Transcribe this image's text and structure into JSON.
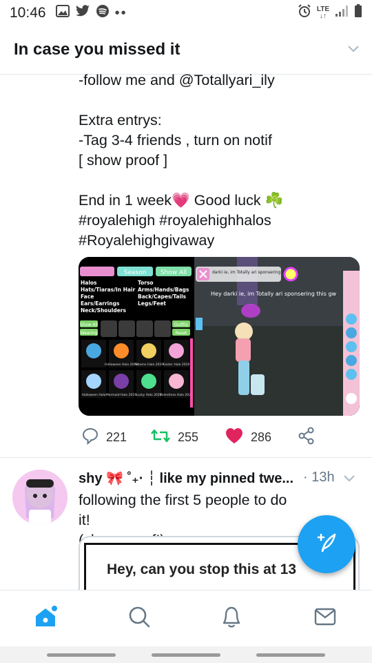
{
  "status_bar": {
    "time": "10:46",
    "network": "LTE",
    "left_icons": [
      "gallery-icon",
      "twitter-icon",
      "spotify-icon",
      "more-dots-icon"
    ],
    "right_icons": [
      "alarm-icon",
      "lte-icon",
      "signal-icon",
      "battery-icon"
    ]
  },
  "header": {
    "title": "In case you missed it"
  },
  "tweet1": {
    "text_lines": [
      "-follow me and @Totallyari_ily",
      "",
      "Extra entrys:",
      "-Tag 3-4 friends , turn on notif",
      "[ show proof ]",
      "",
      "End in 1 week💗 Good luck ☘️",
      "#royalehigh #royalehighhalos",
      "#Royalehighgivaway"
    ],
    "media": {
      "tabs": [
        "Season",
        "Show All"
      ],
      "categories_left": [
        "Halos",
        "Hats/Tiaras/In Hair",
        "Face",
        "Ears/Earrings",
        "Neck/Shoulders"
      ],
      "categories_right": [
        "Torso",
        "Arms/Hands/Bags",
        "Back/Capes/Tails",
        "Legs/Feet"
      ],
      "buttons": [
        "Show All",
        "Wearing",
        "Outfits",
        "Reset"
      ],
      "item_names": [
        "Halloween Halo 2019",
        "Autumn Halo 2019",
        "Easter Halo 2019",
        "Halloween Halo",
        "Mermaid Halo 2019",
        "Lucky Halo 2020",
        "Valentines Halo 2020"
      ],
      "chat_bubble": "darki ie, im Totally ari sponsering this gw",
      "chat_text": "Hey darki ie, im Totally ari sponsering this gw"
    },
    "replies": "221",
    "retweets": "255",
    "likes": "286"
  },
  "tweet2": {
    "name": "shy 🎀 ˚₊· ┆ like my pinned twe...",
    "time": "· 13h",
    "text_lines": [
      "following the first 5 people to do it!",
      "(show proof!)"
    ],
    "media_caption": "Hey, can you stop this at 13"
  },
  "nav": {
    "items": [
      "home-icon",
      "search-icon",
      "notifications-icon",
      "messages-icon"
    ]
  },
  "colors": {
    "accent": "#1da1f2",
    "like": "#e0245e",
    "retweet": "#17bf63"
  }
}
